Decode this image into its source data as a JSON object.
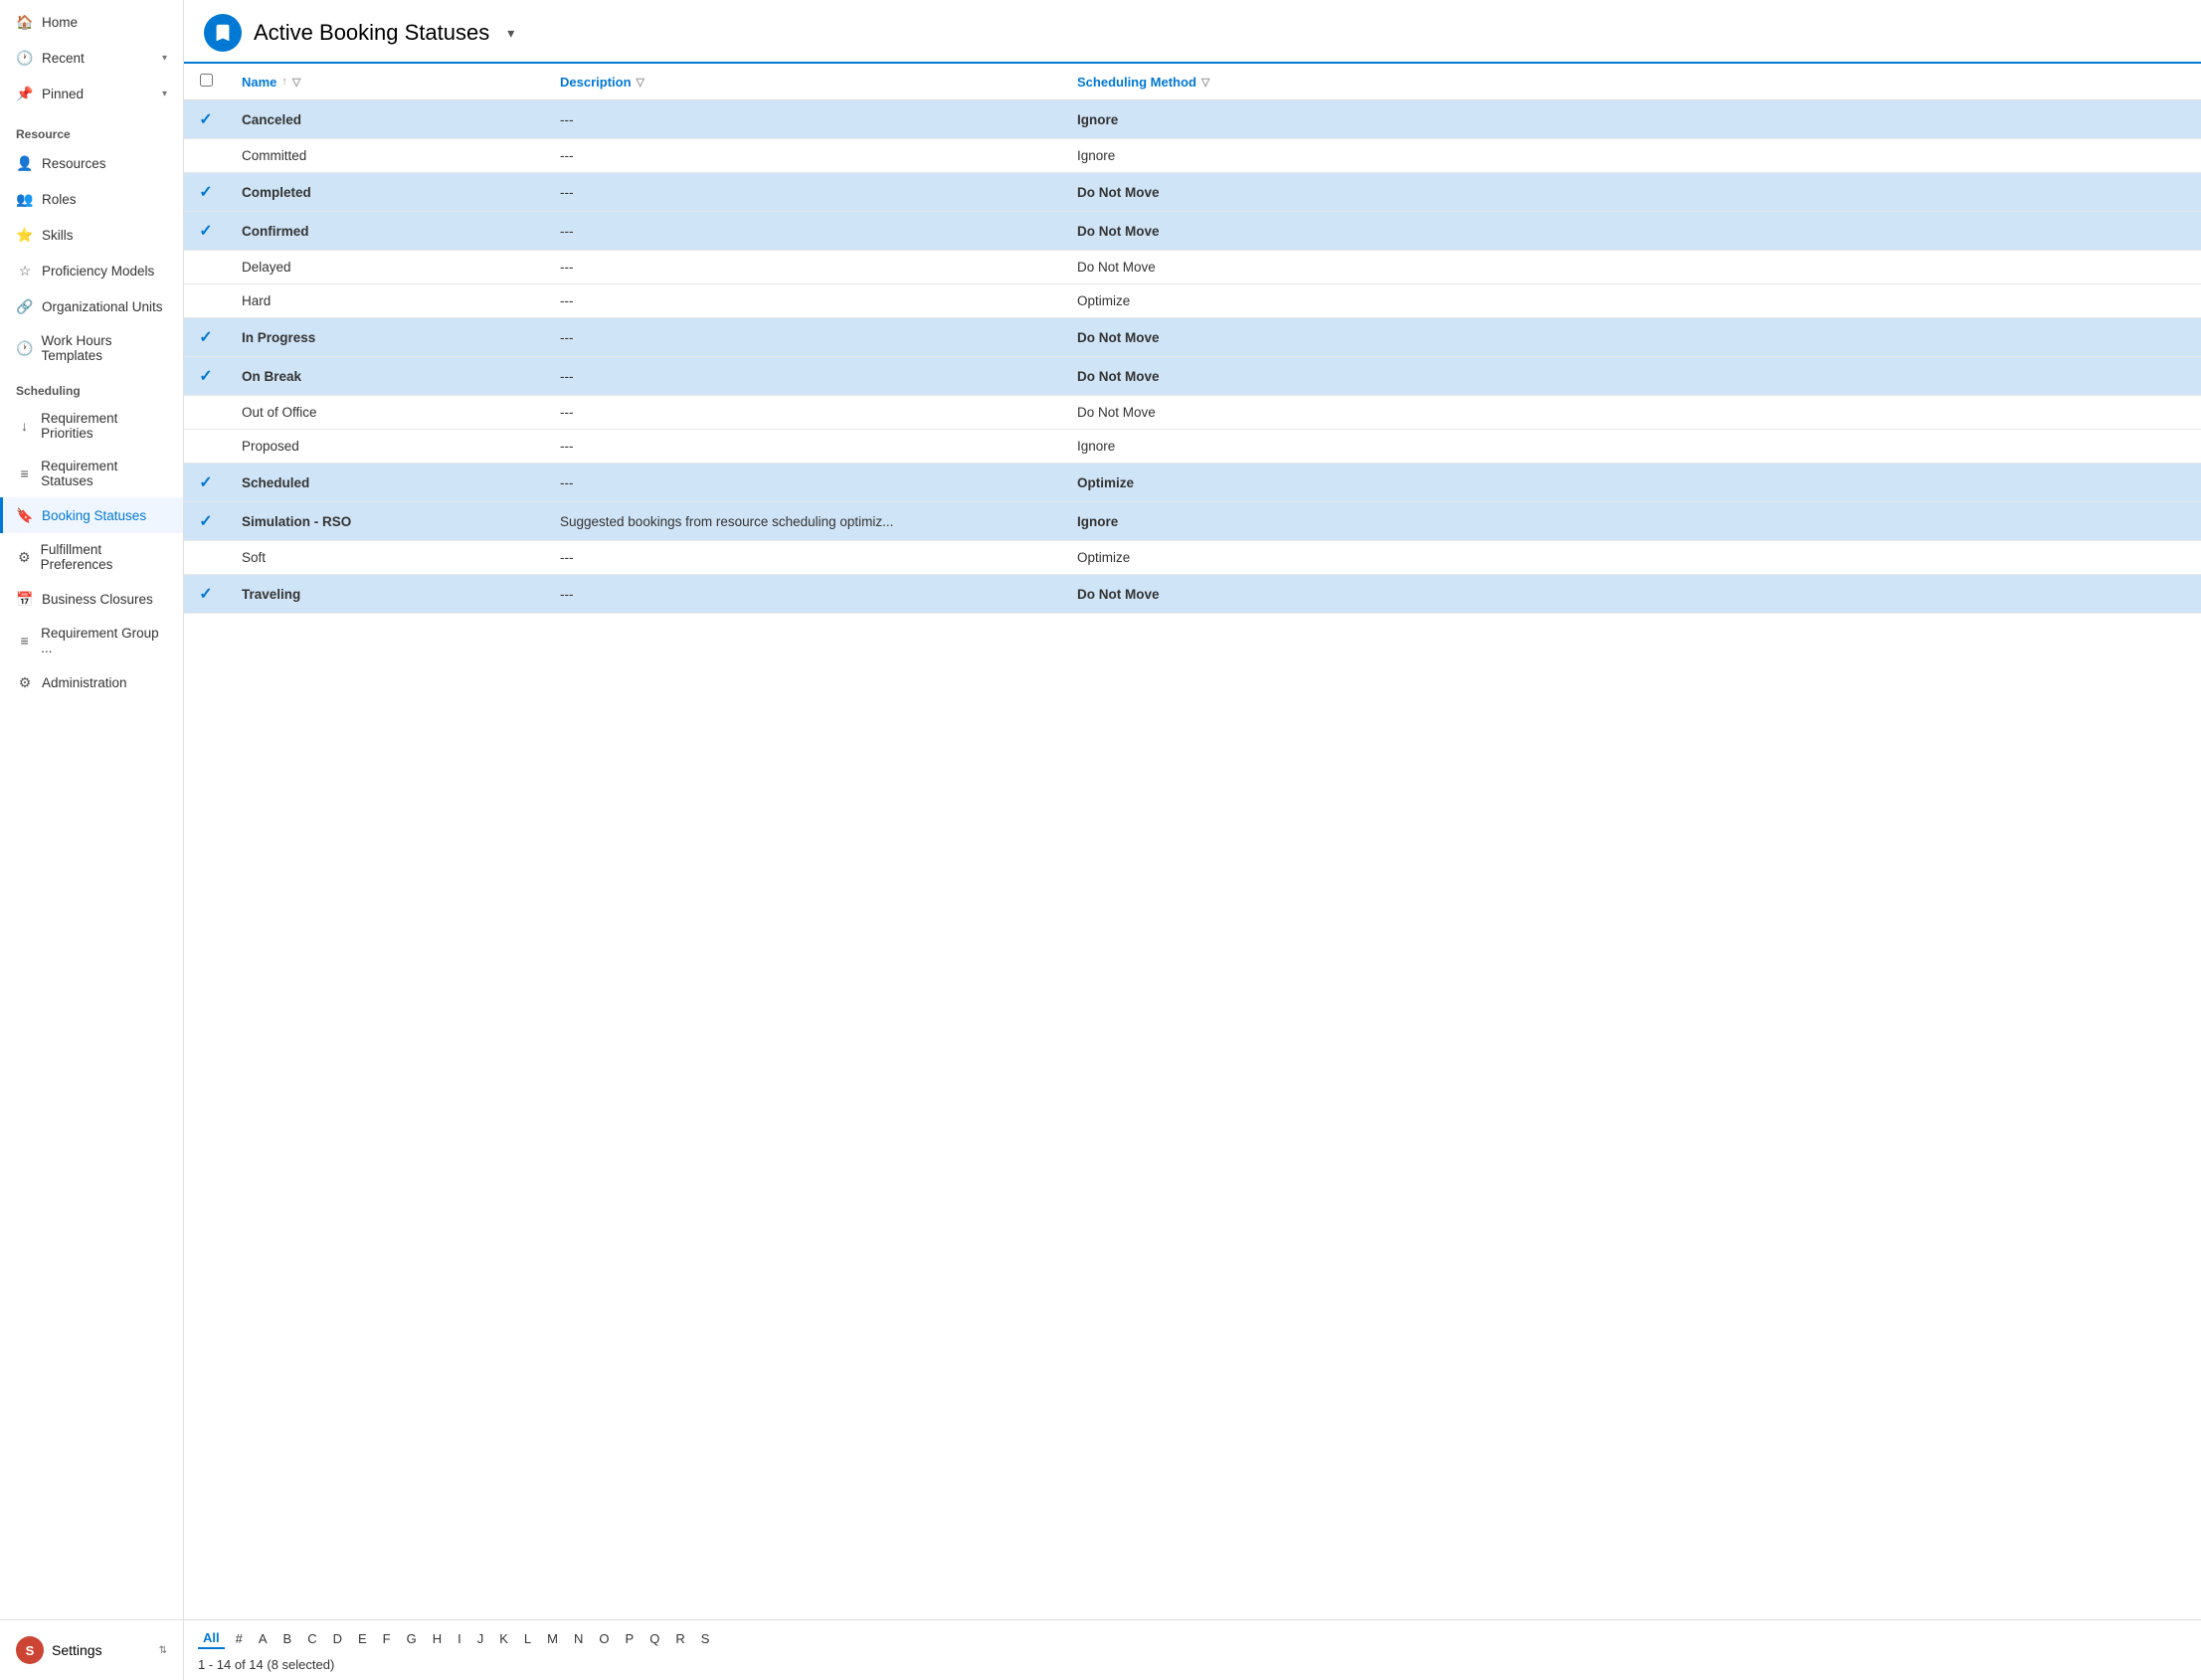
{
  "sidebar": {
    "nav_top": [
      {
        "label": "Home",
        "icon": "🏠",
        "id": "home",
        "expandable": false
      },
      {
        "label": "Recent",
        "icon": "🕐",
        "id": "recent",
        "expandable": true
      },
      {
        "label": "Pinned",
        "icon": "📌",
        "id": "pinned",
        "expandable": true
      }
    ],
    "section_resource": {
      "label": "Resource",
      "items": [
        {
          "label": "Resources",
          "icon": "👤",
          "id": "resources",
          "active": false
        },
        {
          "label": "Roles",
          "icon": "👥",
          "id": "roles",
          "active": false
        },
        {
          "label": "Skills",
          "icon": "⭐",
          "id": "skills",
          "active": false
        },
        {
          "label": "Proficiency Models",
          "icon": "☆",
          "id": "proficiency-models",
          "active": false
        },
        {
          "label": "Organizational Units",
          "icon": "🔗",
          "id": "organizational-units",
          "active": false
        },
        {
          "label": "Work Hours Templates",
          "icon": "🕐",
          "id": "work-hours-templates",
          "active": false
        }
      ]
    },
    "section_scheduling": {
      "label": "Scheduling",
      "items": [
        {
          "label": "Requirement Priorities",
          "icon": "↓",
          "id": "requirement-priorities",
          "active": false
        },
        {
          "label": "Requirement Statuses",
          "icon": "≡",
          "id": "requirement-statuses",
          "active": false
        },
        {
          "label": "Booking Statuses",
          "icon": "🔖",
          "id": "booking-statuses",
          "active": true
        },
        {
          "label": "Fulfillment Preferences",
          "icon": "⚙",
          "id": "fulfillment-preferences",
          "active": false
        },
        {
          "label": "Business Closures",
          "icon": "📅",
          "id": "business-closures",
          "active": false
        },
        {
          "label": "Requirement Group ...",
          "icon": "≡",
          "id": "requirement-group",
          "active": false
        },
        {
          "label": "Administration",
          "icon": "⚙",
          "id": "administration",
          "active": false
        }
      ]
    },
    "settings_label": "Settings"
  },
  "header": {
    "title": "Active Booking Statuses",
    "icon_char": "🔖"
  },
  "table": {
    "columns": [
      {
        "label": "Name",
        "id": "name",
        "sortable": true,
        "filterable": true
      },
      {
        "label": "Description",
        "id": "description",
        "sortable": false,
        "filterable": true
      },
      {
        "label": "Scheduling Method",
        "id": "scheduling_method",
        "sortable": false,
        "filterable": true
      }
    ],
    "rows": [
      {
        "name": "Canceled",
        "description": "---",
        "scheduling_method": "Ignore",
        "selected": true,
        "bold": true
      },
      {
        "name": "Committed",
        "description": "---",
        "scheduling_method": "Ignore",
        "selected": false,
        "bold": false
      },
      {
        "name": "Completed",
        "description": "---",
        "scheduling_method": "Do Not Move",
        "selected": true,
        "bold": true
      },
      {
        "name": "Confirmed",
        "description": "---",
        "scheduling_method": "Do Not Move",
        "selected": true,
        "bold": true
      },
      {
        "name": "Delayed",
        "description": "---",
        "scheduling_method": "Do Not Move",
        "selected": false,
        "bold": false
      },
      {
        "name": "Hard",
        "description": "---",
        "scheduling_method": "Optimize",
        "selected": false,
        "bold": false
      },
      {
        "name": "In Progress",
        "description": "---",
        "scheduling_method": "Do Not Move",
        "selected": true,
        "bold": true
      },
      {
        "name": "On Break",
        "description": "---",
        "scheduling_method": "Do Not Move",
        "selected": true,
        "bold": true
      },
      {
        "name": "Out of Office",
        "description": "---",
        "scheduling_method": "Do Not Move",
        "selected": false,
        "bold": false
      },
      {
        "name": "Proposed",
        "description": "---",
        "scheduling_method": "Ignore",
        "selected": false,
        "bold": false
      },
      {
        "name": "Scheduled",
        "description": "---",
        "scheduling_method": "Optimize",
        "selected": true,
        "bold": true
      },
      {
        "name": "Simulation - RSO",
        "description": "Suggested bookings from resource scheduling optimiz...",
        "scheduling_method": "Ignore",
        "selected": true,
        "bold": true
      },
      {
        "name": "Soft",
        "description": "---",
        "scheduling_method": "Optimize",
        "selected": false,
        "bold": false
      },
      {
        "name": "Traveling",
        "description": "---",
        "scheduling_method": "Do Not Move",
        "selected": true,
        "bold": true
      }
    ]
  },
  "pagination": {
    "alpha_letters": [
      "All",
      "#",
      "A",
      "B",
      "C",
      "D",
      "E",
      "F",
      "G",
      "H",
      "I",
      "J",
      "K",
      "L",
      "M",
      "N",
      "O",
      "P",
      "Q",
      "R",
      "S"
    ],
    "active_letter": "All",
    "info": "1 - 14 of 14 (8 selected)"
  }
}
